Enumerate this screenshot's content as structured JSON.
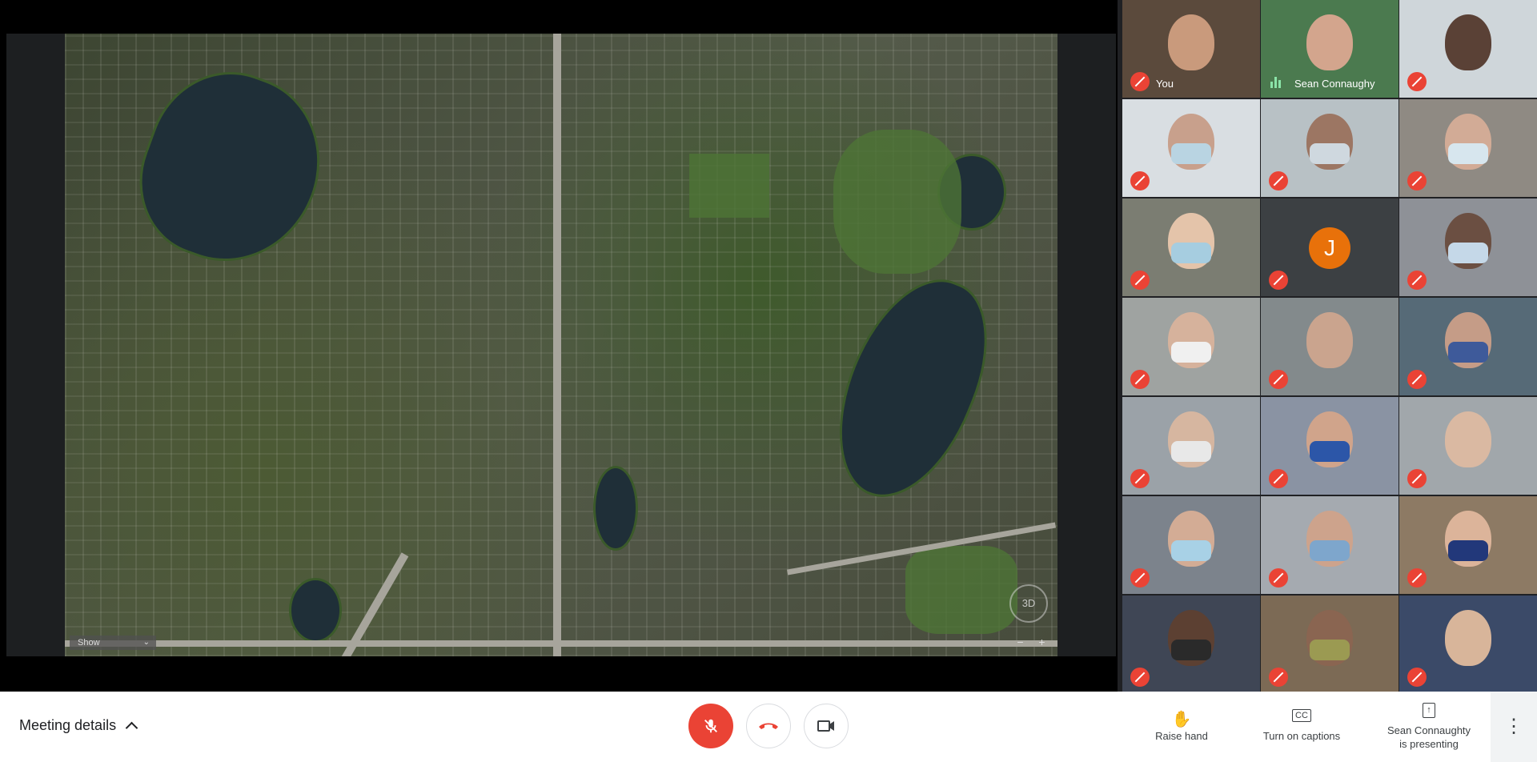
{
  "presentation": {
    "map_show_label": "Show",
    "map_3d_label": "3D",
    "zoom_out": "−",
    "zoom_in": "+"
  },
  "participants": [
    {
      "name": "You",
      "bg": "#5b4a3c",
      "face": "#c99a7c",
      "mask": null,
      "muted": true
    },
    {
      "name": "Sean Connaughy",
      "bg": "#4b7a4f",
      "face": "#d3a58d",
      "mask": null,
      "muted": false,
      "speaking": true
    },
    {
      "name": "",
      "bg": "#cfd6da",
      "face": "#5a4136",
      "mask": null,
      "muted": true
    },
    {
      "name": "",
      "bg": "#d9dee2",
      "face": "#c8a08c",
      "mask": "#b9d4e2",
      "muted": true
    },
    {
      "name": "",
      "bg": "#b8c1c5",
      "face": "#9c7663",
      "mask": "#cfd8df",
      "muted": true
    },
    {
      "name": "",
      "bg": "#8f8a83",
      "face": "#d2ab96",
      "mask": "#d7e6ee",
      "muted": true
    },
    {
      "name": "",
      "bg": "#7b7d72",
      "face": "#e4c4aa",
      "mask": "#a6cde0",
      "muted": true
    },
    {
      "name": "",
      "avatar": "J",
      "bg": "#3c4043",
      "muted": true
    },
    {
      "name": "",
      "bg": "#8e9197",
      "face": "#6b4f42",
      "mask": "#c5d8e8",
      "muted": true
    },
    {
      "name": "",
      "bg": "#9fa3a1",
      "face": "#d6b29c",
      "mask": "#f0f0f0",
      "muted": true
    },
    {
      "name": "",
      "bg": "#838a8c",
      "face": "#caa48e",
      "mask": null,
      "muted": true
    },
    {
      "name": "",
      "bg": "#566a77",
      "face": "#c59c87",
      "mask": "#3e5a9a",
      "muted": true
    },
    {
      "name": "",
      "bg": "#9ba2a8",
      "face": "#d6b6a0",
      "mask": "#e8e8e8",
      "muted": true
    },
    {
      "name": "",
      "bg": "#8a93a3",
      "face": "#d0a48b",
      "mask": "#2c56a8",
      "muted": true
    },
    {
      "name": "",
      "bg": "#a1a7ab",
      "face": "#dab9a2",
      "mask": null,
      "muted": true
    },
    {
      "name": "",
      "bg": "#7c838c",
      "face": "#d3ac95",
      "mask": "#a8d1e6",
      "muted": true
    },
    {
      "name": "",
      "bg": "#a5aab0",
      "face": "#cda38c",
      "mask": "#7ea6cc",
      "muted": true
    },
    {
      "name": "",
      "bg": "#8d7a64",
      "face": "#dcb49a",
      "mask": "#22387a",
      "muted": true
    },
    {
      "name": "",
      "bg": "#3f4655",
      "face": "#5c4032",
      "mask": "#2a2a2a",
      "muted": true
    },
    {
      "name": "",
      "bg": "#7c6a55",
      "face": "#8a6551",
      "mask": "#9b9a52",
      "muted": true
    },
    {
      "name": "",
      "bg": "#3b4a68",
      "face": "#d8b59a",
      "mask": null,
      "muted": true
    }
  ],
  "bottom_bar": {
    "meeting_details": "Meeting details",
    "raise_hand": "Raise hand",
    "captions": "Turn on captions",
    "presenting_line1": "Sean Connaughty",
    "presenting_line2": "is presenting",
    "more": "⋮"
  },
  "colors": {
    "mute_red": "#ea4335",
    "speaking_green": "#8be4a8",
    "avatar_orange": "#e8710a"
  }
}
